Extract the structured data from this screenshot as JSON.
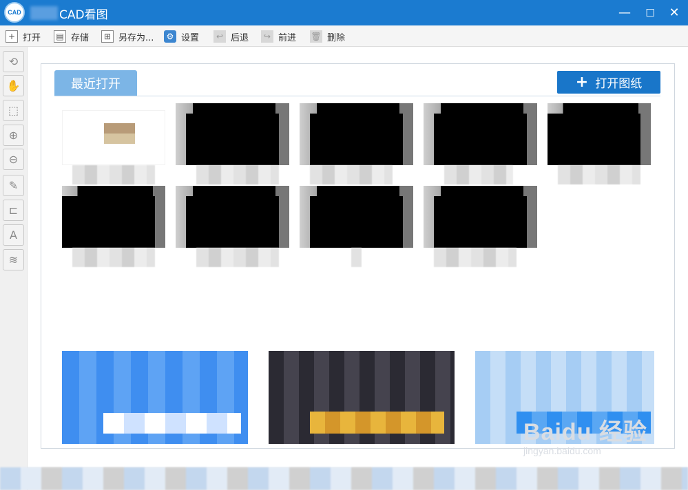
{
  "window": {
    "title": "CAD看图",
    "logo_text": "CAD",
    "minimize_symbol": "—",
    "maximize_symbol": "☐",
    "close_symbol": "✕"
  },
  "toolbar": {
    "items": [
      {
        "label": "打开",
        "icon": "plus-icon",
        "symbol": "+"
      },
      {
        "label": "存储",
        "icon": "save-icon",
        "symbol": "▤"
      },
      {
        "label": "另存为...",
        "icon": "save-as-icon",
        "symbol": "⊞"
      },
      {
        "label": "设置",
        "icon": "gear-icon",
        "symbol": "⚙"
      },
      {
        "label": "后退",
        "icon": "back-arrow-icon",
        "symbol": "↩"
      },
      {
        "label": "前进",
        "icon": "forward-arrow-icon",
        "symbol": "↪"
      },
      {
        "label": "删除",
        "icon": "trash-icon",
        "symbol": "🗑"
      }
    ]
  },
  "tools": [
    {
      "name": "rotate-zoom-icon",
      "symbol": "⟲"
    },
    {
      "name": "pan-hand-icon",
      "symbol": "✋"
    },
    {
      "name": "zoom-window-icon",
      "symbol": "⬚"
    },
    {
      "name": "zoom-in-icon",
      "symbol": "⊕"
    },
    {
      "name": "zoom-out-icon",
      "symbol": "⊖"
    },
    {
      "name": "pen-icon",
      "symbol": "✎"
    },
    {
      "name": "measure-icon",
      "symbol": "⊏"
    },
    {
      "name": "text-icon",
      "symbol": "A"
    },
    {
      "name": "layers-icon",
      "symbol": "≋"
    }
  ],
  "recent": {
    "tab_label": "最近打开",
    "open_button_label": "打开图纸",
    "open_button_symbol": "+"
  },
  "watermark": {
    "main": "Baidu 经验",
    "sub": "jingyan.baidu.com"
  },
  "colors": {
    "titlebar": "#1b7bd0",
    "tab": "#7cb5e6",
    "open_button": "#1976c9"
  }
}
